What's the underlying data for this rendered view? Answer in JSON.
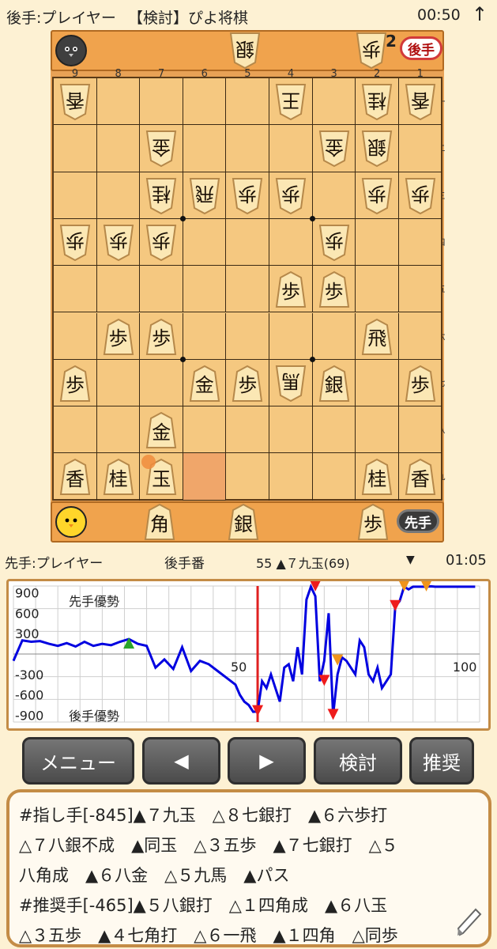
{
  "header": {
    "player": "後手:プレイヤー",
    "mode": "【検討】ぴよ将棋",
    "time": "00:50",
    "arrow": "↑"
  },
  "board": {
    "col_numbers": [
      "9",
      "8",
      "7",
      "6",
      "5",
      "4",
      "3",
      "2",
      "1"
    ],
    "row_numbers": [
      "一",
      "二",
      "三",
      "四",
      "五",
      "六",
      "七",
      "八",
      "九"
    ],
    "pieces": [
      {
        "r": 0,
        "c": 0,
        "ch": "香",
        "side": "gote"
      },
      {
        "r": 0,
        "c": 5,
        "ch": "王",
        "side": "gote"
      },
      {
        "r": 0,
        "c": 7,
        "ch": "桂",
        "side": "gote"
      },
      {
        "r": 0,
        "c": 8,
        "ch": "香",
        "side": "gote"
      },
      {
        "r": 1,
        "c": 2,
        "ch": "金",
        "side": "gote"
      },
      {
        "r": 1,
        "c": 6,
        "ch": "金",
        "side": "gote"
      },
      {
        "r": 1,
        "c": 7,
        "ch": "銀",
        "side": "gote"
      },
      {
        "r": 2,
        "c": 2,
        "ch": "桂",
        "side": "gote"
      },
      {
        "r": 2,
        "c": 3,
        "ch": "飛",
        "side": "gote"
      },
      {
        "r": 2,
        "c": 4,
        "ch": "歩",
        "side": "gote"
      },
      {
        "r": 2,
        "c": 5,
        "ch": "歩",
        "side": "gote"
      },
      {
        "r": 2,
        "c": 7,
        "ch": "歩",
        "side": "gote"
      },
      {
        "r": 2,
        "c": 8,
        "ch": "歩",
        "side": "gote"
      },
      {
        "r": 3,
        "c": 0,
        "ch": "歩",
        "side": "gote"
      },
      {
        "r": 3,
        "c": 1,
        "ch": "歩",
        "side": "gote"
      },
      {
        "r": 3,
        "c": 2,
        "ch": "歩",
        "side": "gote"
      },
      {
        "r": 3,
        "c": 6,
        "ch": "歩",
        "side": "gote"
      },
      {
        "r": 4,
        "c": 5,
        "ch": "歩",
        "side": "sente"
      },
      {
        "r": 4,
        "c": 6,
        "ch": "歩",
        "side": "sente"
      },
      {
        "r": 5,
        "c": 1,
        "ch": "歩",
        "side": "sente"
      },
      {
        "r": 5,
        "c": 2,
        "ch": "歩",
        "side": "sente"
      },
      {
        "r": 5,
        "c": 7,
        "ch": "飛",
        "side": "sente"
      },
      {
        "r": 6,
        "c": 0,
        "ch": "歩",
        "side": "sente"
      },
      {
        "r": 6,
        "c": 3,
        "ch": "金",
        "side": "sente"
      },
      {
        "r": 6,
        "c": 4,
        "ch": "歩",
        "side": "sente"
      },
      {
        "r": 6,
        "c": 5,
        "ch": "馬",
        "side": "gote"
      },
      {
        "r": 6,
        "c": 6,
        "ch": "銀",
        "side": "sente"
      },
      {
        "r": 6,
        "c": 8,
        "ch": "歩",
        "side": "sente"
      },
      {
        "r": 7,
        "c": 2,
        "ch": "金",
        "side": "sente"
      },
      {
        "r": 8,
        "c": 0,
        "ch": "香",
        "side": "sente"
      },
      {
        "r": 8,
        "c": 1,
        "ch": "桂",
        "side": "sente"
      },
      {
        "r": 8,
        "c": 2,
        "ch": "玉",
        "side": "sente"
      },
      {
        "r": 8,
        "c": 7,
        "ch": "桂",
        "side": "sente"
      },
      {
        "r": 8,
        "c": 8,
        "ch": "香",
        "side": "sente"
      }
    ],
    "last_move_square": {
      "r": 8,
      "c": 2
    },
    "from_square": {
      "r": 8,
      "c": 3
    }
  },
  "gote_hand": {
    "pieces": [
      {
        "ch": "銀",
        "count": ""
      },
      {
        "ch": "歩",
        "count": "2"
      }
    ],
    "badge": "後手"
  },
  "sente_hand": {
    "pieces": [
      {
        "ch": "角",
        "count": ""
      },
      {
        "ch": "銀",
        "count": ""
      },
      {
        "ch": "歩",
        "count": ""
      }
    ],
    "badge": "先手"
  },
  "info": {
    "player": "先手:プレイヤー",
    "turn": "後手番",
    "move": "55 ▲７九玉(69)",
    "dropdown": "▼",
    "time": "01:05"
  },
  "graph": {
    "y_labels": [
      "900",
      "600",
      "300",
      "-300",
      "-600",
      "-900"
    ],
    "top_label": "先手優勢",
    "bottom_label": "後手優勢",
    "x_labels": [
      "50",
      "100"
    ]
  },
  "chart_data": {
    "type": "line",
    "title": "",
    "xlabel": "",
    "ylabel": "",
    "ylim": [
      -1000,
      1000
    ],
    "xlim": [
      0,
      105
    ],
    "x": [
      0,
      2,
      4,
      6,
      8,
      10,
      12,
      14,
      16,
      18,
      20,
      22,
      24,
      26,
      28,
      30,
      32,
      34,
      36,
      38,
      40,
      42,
      44,
      46,
      48,
      50,
      51,
      52,
      53,
      54,
      55,
      56,
      57,
      58,
      60,
      61,
      62,
      63,
      64,
      65,
      66,
      67,
      68,
      69,
      70,
      71,
      72,
      73,
      74,
      75,
      76,
      77,
      78,
      79,
      80,
      81,
      82,
      83,
      84,
      85,
      86,
      87,
      88,
      89,
      90,
      91,
      92,
      93,
      94,
      95,
      96,
      98,
      100,
      102,
      104
    ],
    "series": [
      {
        "values": [
          -100,
          200,
          180,
          190,
          150,
          120,
          160,
          110,
          180,
          120,
          150,
          130,
          180,
          220,
          150,
          120,
          -200,
          -80,
          -220,
          100,
          -250,
          -100,
          -150,
          -250,
          -350,
          -450,
          -600,
          -700,
          -750,
          -850,
          -845,
          -400,
          -500,
          -300,
          -700,
          -200,
          -150,
          -400,
          100,
          -300,
          800,
          990,
          850,
          -400,
          -100,
          600,
          -900,
          -300,
          -50,
          -100,
          -200,
          -300,
          200,
          100,
          -300,
          -400,
          -200,
          -500,
          -400,
          -300,
          700,
          780,
          990,
          950,
          990,
          990,
          990,
          990,
          995,
          990,
          990,
          990,
          990,
          990,
          990
        ]
      }
    ],
    "legend": "none",
    "grid": true
  },
  "buttons": {
    "menu": "メニュー",
    "prev": "◀",
    "next": "▶",
    "analyze": "検討",
    "recommend": "推奨"
  },
  "comment": {
    "lines": [
      "#指し手[-845]▲７九玉　△８七銀打　▲６六歩打",
      "△７八銀不成　▲同玉　△３五歩　▲７七銀打　△５",
      "八角成　▲６八金　△５九馬　▲パス",
      "#推奨手[-465]▲５八銀打　△１四角成　▲６八玉",
      "△３五歩　▲４七角打　△６一飛　▲１四角　△同歩"
    ]
  },
  "colors": {
    "board": "#f5c880",
    "frame": "#e8a256",
    "line": "#0000e0",
    "current": "#e02020"
  }
}
